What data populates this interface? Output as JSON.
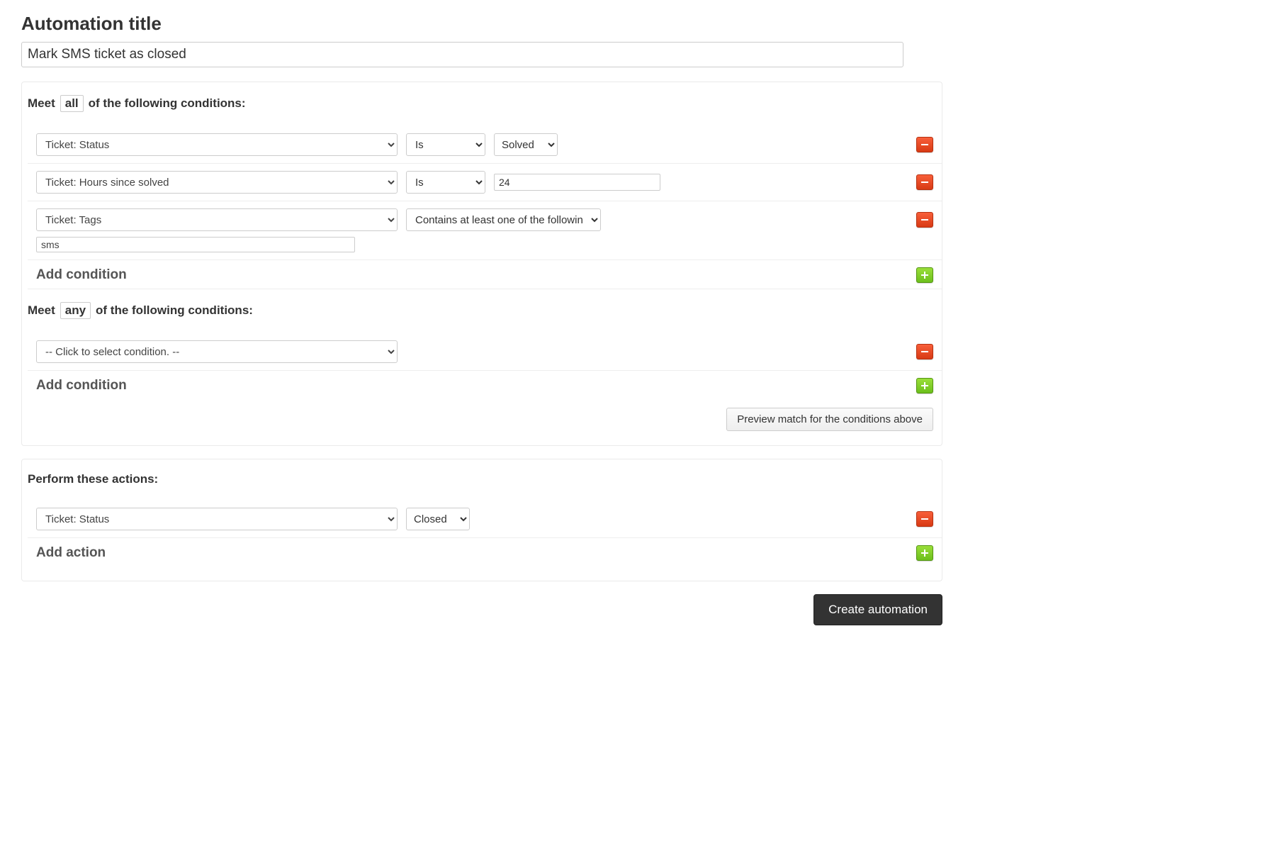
{
  "page": {
    "title_label": "Automation title",
    "title_value": "Mark SMS ticket as closed"
  },
  "conditions_all": {
    "prefix": "Meet",
    "chip": "all",
    "suffix": "of the following conditions:",
    "rows": [
      {
        "field": "Ticket: Status",
        "operator": "Is",
        "value_select": "Solved"
      },
      {
        "field": "Ticket: Hours since solved",
        "operator": "Is",
        "value_text": "24"
      },
      {
        "field": "Ticket: Tags",
        "operator_long": "Contains at least one of the following",
        "tag_value": "sms"
      }
    ],
    "add_label": "Add condition"
  },
  "conditions_any": {
    "prefix": "Meet",
    "chip": "any",
    "suffix": "of the following conditions:",
    "placeholder_option": "-- Click to select condition. --",
    "add_label": "Add condition"
  },
  "preview_button": "Preview match for the conditions above",
  "actions": {
    "label": "Perform these actions:",
    "rows": [
      {
        "field": "Ticket: Status",
        "value_select": "Closed"
      }
    ],
    "add_label": "Add action"
  },
  "create_button": "Create automation"
}
